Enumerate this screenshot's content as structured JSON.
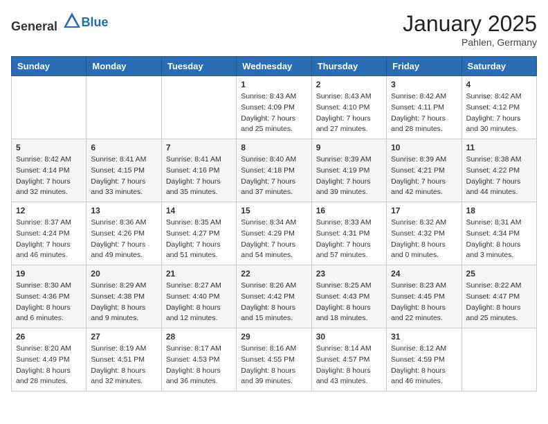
{
  "logo": {
    "general": "General",
    "blue": "Blue"
  },
  "title": {
    "month_year": "January 2025",
    "location": "Pahlen, Germany"
  },
  "weekdays": [
    "Sunday",
    "Monday",
    "Tuesday",
    "Wednesday",
    "Thursday",
    "Friday",
    "Saturday"
  ],
  "weeks": [
    [
      {
        "day": "",
        "sunrise": "",
        "sunset": "",
        "daylight": ""
      },
      {
        "day": "",
        "sunrise": "",
        "sunset": "",
        "daylight": ""
      },
      {
        "day": "",
        "sunrise": "",
        "sunset": "",
        "daylight": ""
      },
      {
        "day": "1",
        "sunrise": "Sunrise: 8:43 AM",
        "sunset": "Sunset: 4:09 PM",
        "daylight": "Daylight: 7 hours and 25 minutes."
      },
      {
        "day": "2",
        "sunrise": "Sunrise: 8:43 AM",
        "sunset": "Sunset: 4:10 PM",
        "daylight": "Daylight: 7 hours and 27 minutes."
      },
      {
        "day": "3",
        "sunrise": "Sunrise: 8:42 AM",
        "sunset": "Sunset: 4:11 PM",
        "daylight": "Daylight: 7 hours and 28 minutes."
      },
      {
        "day": "4",
        "sunrise": "Sunrise: 8:42 AM",
        "sunset": "Sunset: 4:12 PM",
        "daylight": "Daylight: 7 hours and 30 minutes."
      }
    ],
    [
      {
        "day": "5",
        "sunrise": "Sunrise: 8:42 AM",
        "sunset": "Sunset: 4:14 PM",
        "daylight": "Daylight: 7 hours and 32 minutes."
      },
      {
        "day": "6",
        "sunrise": "Sunrise: 8:41 AM",
        "sunset": "Sunset: 4:15 PM",
        "daylight": "Daylight: 7 hours and 33 minutes."
      },
      {
        "day": "7",
        "sunrise": "Sunrise: 8:41 AM",
        "sunset": "Sunset: 4:16 PM",
        "daylight": "Daylight: 7 hours and 35 minutes."
      },
      {
        "day": "8",
        "sunrise": "Sunrise: 8:40 AM",
        "sunset": "Sunset: 4:18 PM",
        "daylight": "Daylight: 7 hours and 37 minutes."
      },
      {
        "day": "9",
        "sunrise": "Sunrise: 8:39 AM",
        "sunset": "Sunset: 4:19 PM",
        "daylight": "Daylight: 7 hours and 39 minutes."
      },
      {
        "day": "10",
        "sunrise": "Sunrise: 8:39 AM",
        "sunset": "Sunset: 4:21 PM",
        "daylight": "Daylight: 7 hours and 42 minutes."
      },
      {
        "day": "11",
        "sunrise": "Sunrise: 8:38 AM",
        "sunset": "Sunset: 4:22 PM",
        "daylight": "Daylight: 7 hours and 44 minutes."
      }
    ],
    [
      {
        "day": "12",
        "sunrise": "Sunrise: 8:37 AM",
        "sunset": "Sunset: 4:24 PM",
        "daylight": "Daylight: 7 hours and 46 minutes."
      },
      {
        "day": "13",
        "sunrise": "Sunrise: 8:36 AM",
        "sunset": "Sunset: 4:26 PM",
        "daylight": "Daylight: 7 hours and 49 minutes."
      },
      {
        "day": "14",
        "sunrise": "Sunrise: 8:35 AM",
        "sunset": "Sunset: 4:27 PM",
        "daylight": "Daylight: 7 hours and 51 minutes."
      },
      {
        "day": "15",
        "sunrise": "Sunrise: 8:34 AM",
        "sunset": "Sunset: 4:29 PM",
        "daylight": "Daylight: 7 hours and 54 minutes."
      },
      {
        "day": "16",
        "sunrise": "Sunrise: 8:33 AM",
        "sunset": "Sunset: 4:31 PM",
        "daylight": "Daylight: 7 hours and 57 minutes."
      },
      {
        "day": "17",
        "sunrise": "Sunrise: 8:32 AM",
        "sunset": "Sunset: 4:32 PM",
        "daylight": "Daylight: 8 hours and 0 minutes."
      },
      {
        "day": "18",
        "sunrise": "Sunrise: 8:31 AM",
        "sunset": "Sunset: 4:34 PM",
        "daylight": "Daylight: 8 hours and 3 minutes."
      }
    ],
    [
      {
        "day": "19",
        "sunrise": "Sunrise: 8:30 AM",
        "sunset": "Sunset: 4:36 PM",
        "daylight": "Daylight: 8 hours and 6 minutes."
      },
      {
        "day": "20",
        "sunrise": "Sunrise: 8:29 AM",
        "sunset": "Sunset: 4:38 PM",
        "daylight": "Daylight: 8 hours and 9 minutes."
      },
      {
        "day": "21",
        "sunrise": "Sunrise: 8:27 AM",
        "sunset": "Sunset: 4:40 PM",
        "daylight": "Daylight: 8 hours and 12 minutes."
      },
      {
        "day": "22",
        "sunrise": "Sunrise: 8:26 AM",
        "sunset": "Sunset: 4:42 PM",
        "daylight": "Daylight: 8 hours and 15 minutes."
      },
      {
        "day": "23",
        "sunrise": "Sunrise: 8:25 AM",
        "sunset": "Sunset: 4:43 PM",
        "daylight": "Daylight: 8 hours and 18 minutes."
      },
      {
        "day": "24",
        "sunrise": "Sunrise: 8:23 AM",
        "sunset": "Sunset: 4:45 PM",
        "daylight": "Daylight: 8 hours and 22 minutes."
      },
      {
        "day": "25",
        "sunrise": "Sunrise: 8:22 AM",
        "sunset": "Sunset: 4:47 PM",
        "daylight": "Daylight: 8 hours and 25 minutes."
      }
    ],
    [
      {
        "day": "26",
        "sunrise": "Sunrise: 8:20 AM",
        "sunset": "Sunset: 4:49 PM",
        "daylight": "Daylight: 8 hours and 28 minutes."
      },
      {
        "day": "27",
        "sunrise": "Sunrise: 8:19 AM",
        "sunset": "Sunset: 4:51 PM",
        "daylight": "Daylight: 8 hours and 32 minutes."
      },
      {
        "day": "28",
        "sunrise": "Sunrise: 8:17 AM",
        "sunset": "Sunset: 4:53 PM",
        "daylight": "Daylight: 8 hours and 36 minutes."
      },
      {
        "day": "29",
        "sunrise": "Sunrise: 8:16 AM",
        "sunset": "Sunset: 4:55 PM",
        "daylight": "Daylight: 8 hours and 39 minutes."
      },
      {
        "day": "30",
        "sunrise": "Sunrise: 8:14 AM",
        "sunset": "Sunset: 4:57 PM",
        "daylight": "Daylight: 8 hours and 43 minutes."
      },
      {
        "day": "31",
        "sunrise": "Sunrise: 8:12 AM",
        "sunset": "Sunset: 4:59 PM",
        "daylight": "Daylight: 8 hours and 46 minutes."
      },
      {
        "day": "",
        "sunrise": "",
        "sunset": "",
        "daylight": ""
      }
    ]
  ]
}
